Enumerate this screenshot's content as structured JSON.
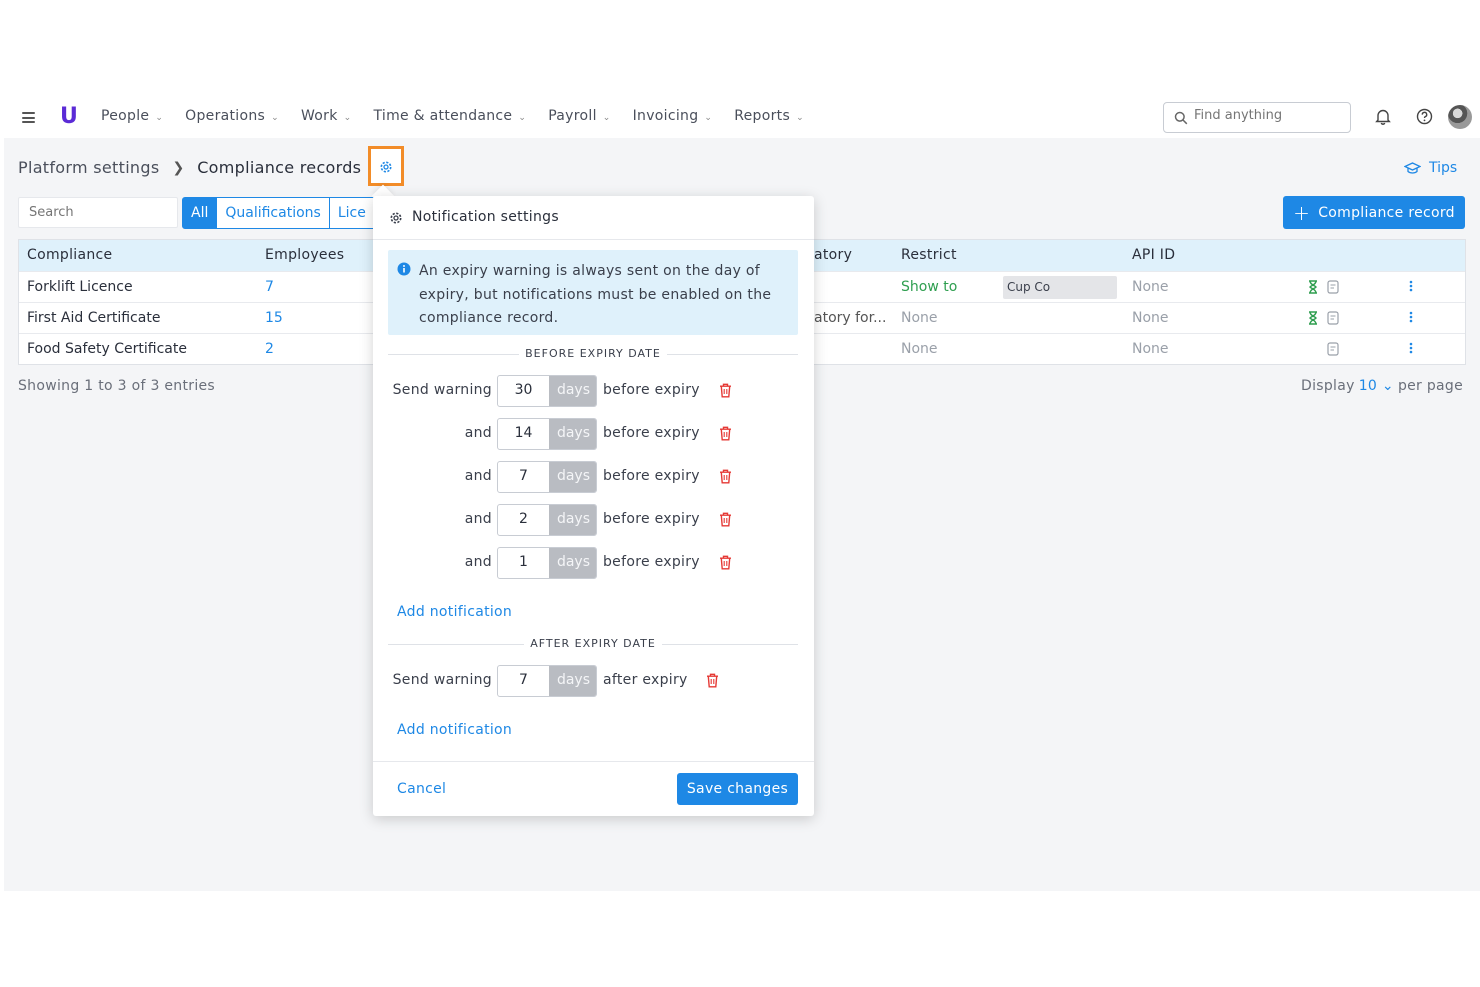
{
  "nav": {
    "logo": "U",
    "items": [
      "People",
      "Operations",
      "Work",
      "Time & attendance",
      "Payroll",
      "Invoicing",
      "Reports"
    ],
    "search_placeholder": "Find anything"
  },
  "breadcrumb": {
    "parent": "Platform settings",
    "current": "Compliance records"
  },
  "tips_label": "Tips",
  "table_search_placeholder": "Search",
  "filter_tabs": [
    "All",
    "Qualifications",
    "Lice"
  ],
  "add_button_label": "Compliance record",
  "table": {
    "headers": {
      "compliance": "Compliance",
      "employees": "Employees",
      "mandatory": "atory",
      "restrict": "Restrict",
      "api_id": "API ID"
    },
    "rows": [
      {
        "compliance": "Forklift Licence",
        "employees": "7",
        "mandatory": "",
        "restrict": "Show to",
        "restrict_target": "Cup Co",
        "api_id": "None"
      },
      {
        "compliance": "First Aid Certificate",
        "employees": "15",
        "mandatory": "atory for...",
        "restrict": "None",
        "api_id": "None"
      },
      {
        "compliance": "Food Safety Certificate",
        "employees": "2",
        "mandatory": "",
        "restrict": "None",
        "api_id": "None"
      }
    ]
  },
  "footer": {
    "showing": "Showing 1 to 3 of 3 entries",
    "display_label": "Display",
    "per_page_value": "10",
    "per_page_suffix": "per page"
  },
  "popup": {
    "title": "Notification settings",
    "info": "An expiry warning is always sent on the day of expiry, but notifications must be enabled on the compliance record.",
    "before_heading": "BEFORE EXPIRY DATE",
    "after_heading": "AFTER EXPIRY DATE",
    "unit": "days",
    "before_rows": [
      {
        "label": "Send warning",
        "value": "30",
        "suffix": "before expiry"
      },
      {
        "label": "and",
        "value": "14",
        "suffix": "before expiry"
      },
      {
        "label": "and",
        "value": "7",
        "suffix": "before expiry"
      },
      {
        "label": "and",
        "value": "2",
        "suffix": "before expiry"
      },
      {
        "label": "and",
        "value": "1",
        "suffix": "before expiry"
      }
    ],
    "after_rows": [
      {
        "label": "Send warning",
        "value": "7",
        "suffix": "after expiry"
      }
    ],
    "add_notification": "Add notification",
    "cancel": "Cancel",
    "save": "Save changes"
  },
  "colors": {
    "accent": "#1e88e5",
    "highlight": "#f28c28",
    "success": "#2e9e4f",
    "danger": "#e53935"
  }
}
